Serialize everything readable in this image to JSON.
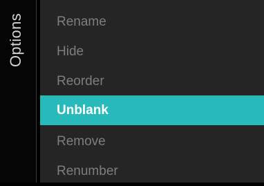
{
  "panel": {
    "title": "Options"
  },
  "menu": {
    "items": [
      {
        "label": "Rename",
        "selected": false
      },
      {
        "label": "Hide",
        "selected": false
      },
      {
        "label": "Reorder",
        "selected": false
      },
      {
        "label": "Unblank",
        "selected": true
      },
      {
        "label": "Remove",
        "selected": false
      },
      {
        "label": "Renumber",
        "selected": false
      }
    ]
  },
  "colors": {
    "highlight": "#28b9bb",
    "menu_background": "#252525",
    "side_background": "#050505",
    "text_dim": "#7e7e7e",
    "text_selected": "#ffffff"
  }
}
